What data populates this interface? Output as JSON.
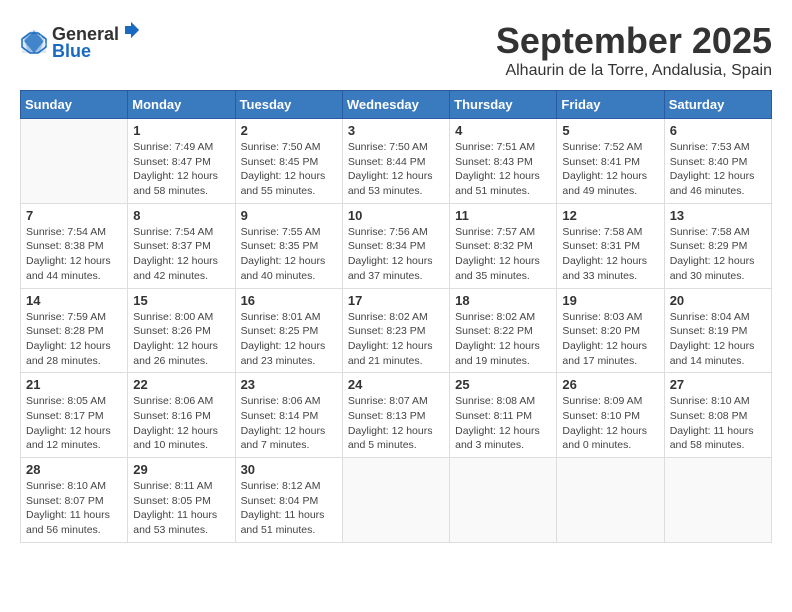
{
  "logo": {
    "general": "General",
    "blue": "Blue"
  },
  "header": {
    "month": "September 2025",
    "location": "Alhaurin de la Torre, Andalusia, Spain"
  },
  "weekdays": [
    "Sunday",
    "Monday",
    "Tuesday",
    "Wednesday",
    "Thursday",
    "Friday",
    "Saturday"
  ],
  "weeks": [
    [
      {
        "day": "",
        "sunrise": "",
        "sunset": "",
        "daylight": ""
      },
      {
        "day": "1",
        "sunrise": "Sunrise: 7:49 AM",
        "sunset": "Sunset: 8:47 PM",
        "daylight": "Daylight: 12 hours and 58 minutes."
      },
      {
        "day": "2",
        "sunrise": "Sunrise: 7:50 AM",
        "sunset": "Sunset: 8:45 PM",
        "daylight": "Daylight: 12 hours and 55 minutes."
      },
      {
        "day": "3",
        "sunrise": "Sunrise: 7:50 AM",
        "sunset": "Sunset: 8:44 PM",
        "daylight": "Daylight: 12 hours and 53 minutes."
      },
      {
        "day": "4",
        "sunrise": "Sunrise: 7:51 AM",
        "sunset": "Sunset: 8:43 PM",
        "daylight": "Daylight: 12 hours and 51 minutes."
      },
      {
        "day": "5",
        "sunrise": "Sunrise: 7:52 AM",
        "sunset": "Sunset: 8:41 PM",
        "daylight": "Daylight: 12 hours and 49 minutes."
      },
      {
        "day": "6",
        "sunrise": "Sunrise: 7:53 AM",
        "sunset": "Sunset: 8:40 PM",
        "daylight": "Daylight: 12 hours and 46 minutes."
      }
    ],
    [
      {
        "day": "7",
        "sunrise": "Sunrise: 7:54 AM",
        "sunset": "Sunset: 8:38 PM",
        "daylight": "Daylight: 12 hours and 44 minutes."
      },
      {
        "day": "8",
        "sunrise": "Sunrise: 7:54 AM",
        "sunset": "Sunset: 8:37 PM",
        "daylight": "Daylight: 12 hours and 42 minutes."
      },
      {
        "day": "9",
        "sunrise": "Sunrise: 7:55 AM",
        "sunset": "Sunset: 8:35 PM",
        "daylight": "Daylight: 12 hours and 40 minutes."
      },
      {
        "day": "10",
        "sunrise": "Sunrise: 7:56 AM",
        "sunset": "Sunset: 8:34 PM",
        "daylight": "Daylight: 12 hours and 37 minutes."
      },
      {
        "day": "11",
        "sunrise": "Sunrise: 7:57 AM",
        "sunset": "Sunset: 8:32 PM",
        "daylight": "Daylight: 12 hours and 35 minutes."
      },
      {
        "day": "12",
        "sunrise": "Sunrise: 7:58 AM",
        "sunset": "Sunset: 8:31 PM",
        "daylight": "Daylight: 12 hours and 33 minutes."
      },
      {
        "day": "13",
        "sunrise": "Sunrise: 7:58 AM",
        "sunset": "Sunset: 8:29 PM",
        "daylight": "Daylight: 12 hours and 30 minutes."
      }
    ],
    [
      {
        "day": "14",
        "sunrise": "Sunrise: 7:59 AM",
        "sunset": "Sunset: 8:28 PM",
        "daylight": "Daylight: 12 hours and 28 minutes."
      },
      {
        "day": "15",
        "sunrise": "Sunrise: 8:00 AM",
        "sunset": "Sunset: 8:26 PM",
        "daylight": "Daylight: 12 hours and 26 minutes."
      },
      {
        "day": "16",
        "sunrise": "Sunrise: 8:01 AM",
        "sunset": "Sunset: 8:25 PM",
        "daylight": "Daylight: 12 hours and 23 minutes."
      },
      {
        "day": "17",
        "sunrise": "Sunrise: 8:02 AM",
        "sunset": "Sunset: 8:23 PM",
        "daylight": "Daylight: 12 hours and 21 minutes."
      },
      {
        "day": "18",
        "sunrise": "Sunrise: 8:02 AM",
        "sunset": "Sunset: 8:22 PM",
        "daylight": "Daylight: 12 hours and 19 minutes."
      },
      {
        "day": "19",
        "sunrise": "Sunrise: 8:03 AM",
        "sunset": "Sunset: 8:20 PM",
        "daylight": "Daylight: 12 hours and 17 minutes."
      },
      {
        "day": "20",
        "sunrise": "Sunrise: 8:04 AM",
        "sunset": "Sunset: 8:19 PM",
        "daylight": "Daylight: 12 hours and 14 minutes."
      }
    ],
    [
      {
        "day": "21",
        "sunrise": "Sunrise: 8:05 AM",
        "sunset": "Sunset: 8:17 PM",
        "daylight": "Daylight: 12 hours and 12 minutes."
      },
      {
        "day": "22",
        "sunrise": "Sunrise: 8:06 AM",
        "sunset": "Sunset: 8:16 PM",
        "daylight": "Daylight: 12 hours and 10 minutes."
      },
      {
        "day": "23",
        "sunrise": "Sunrise: 8:06 AM",
        "sunset": "Sunset: 8:14 PM",
        "daylight": "Daylight: 12 hours and 7 minutes."
      },
      {
        "day": "24",
        "sunrise": "Sunrise: 8:07 AM",
        "sunset": "Sunset: 8:13 PM",
        "daylight": "Daylight: 12 hours and 5 minutes."
      },
      {
        "day": "25",
        "sunrise": "Sunrise: 8:08 AM",
        "sunset": "Sunset: 8:11 PM",
        "daylight": "Daylight: 12 hours and 3 minutes."
      },
      {
        "day": "26",
        "sunrise": "Sunrise: 8:09 AM",
        "sunset": "Sunset: 8:10 PM",
        "daylight": "Daylight: 12 hours and 0 minutes."
      },
      {
        "day": "27",
        "sunrise": "Sunrise: 8:10 AM",
        "sunset": "Sunset: 8:08 PM",
        "daylight": "Daylight: 11 hours and 58 minutes."
      }
    ],
    [
      {
        "day": "28",
        "sunrise": "Sunrise: 8:10 AM",
        "sunset": "Sunset: 8:07 PM",
        "daylight": "Daylight: 11 hours and 56 minutes."
      },
      {
        "day": "29",
        "sunrise": "Sunrise: 8:11 AM",
        "sunset": "Sunset: 8:05 PM",
        "daylight": "Daylight: 11 hours and 53 minutes."
      },
      {
        "day": "30",
        "sunrise": "Sunrise: 8:12 AM",
        "sunset": "Sunset: 8:04 PM",
        "daylight": "Daylight: 11 hours and 51 minutes."
      },
      {
        "day": "",
        "sunrise": "",
        "sunset": "",
        "daylight": ""
      },
      {
        "day": "",
        "sunrise": "",
        "sunset": "",
        "daylight": ""
      },
      {
        "day": "",
        "sunrise": "",
        "sunset": "",
        "daylight": ""
      },
      {
        "day": "",
        "sunrise": "",
        "sunset": "",
        "daylight": ""
      }
    ]
  ]
}
